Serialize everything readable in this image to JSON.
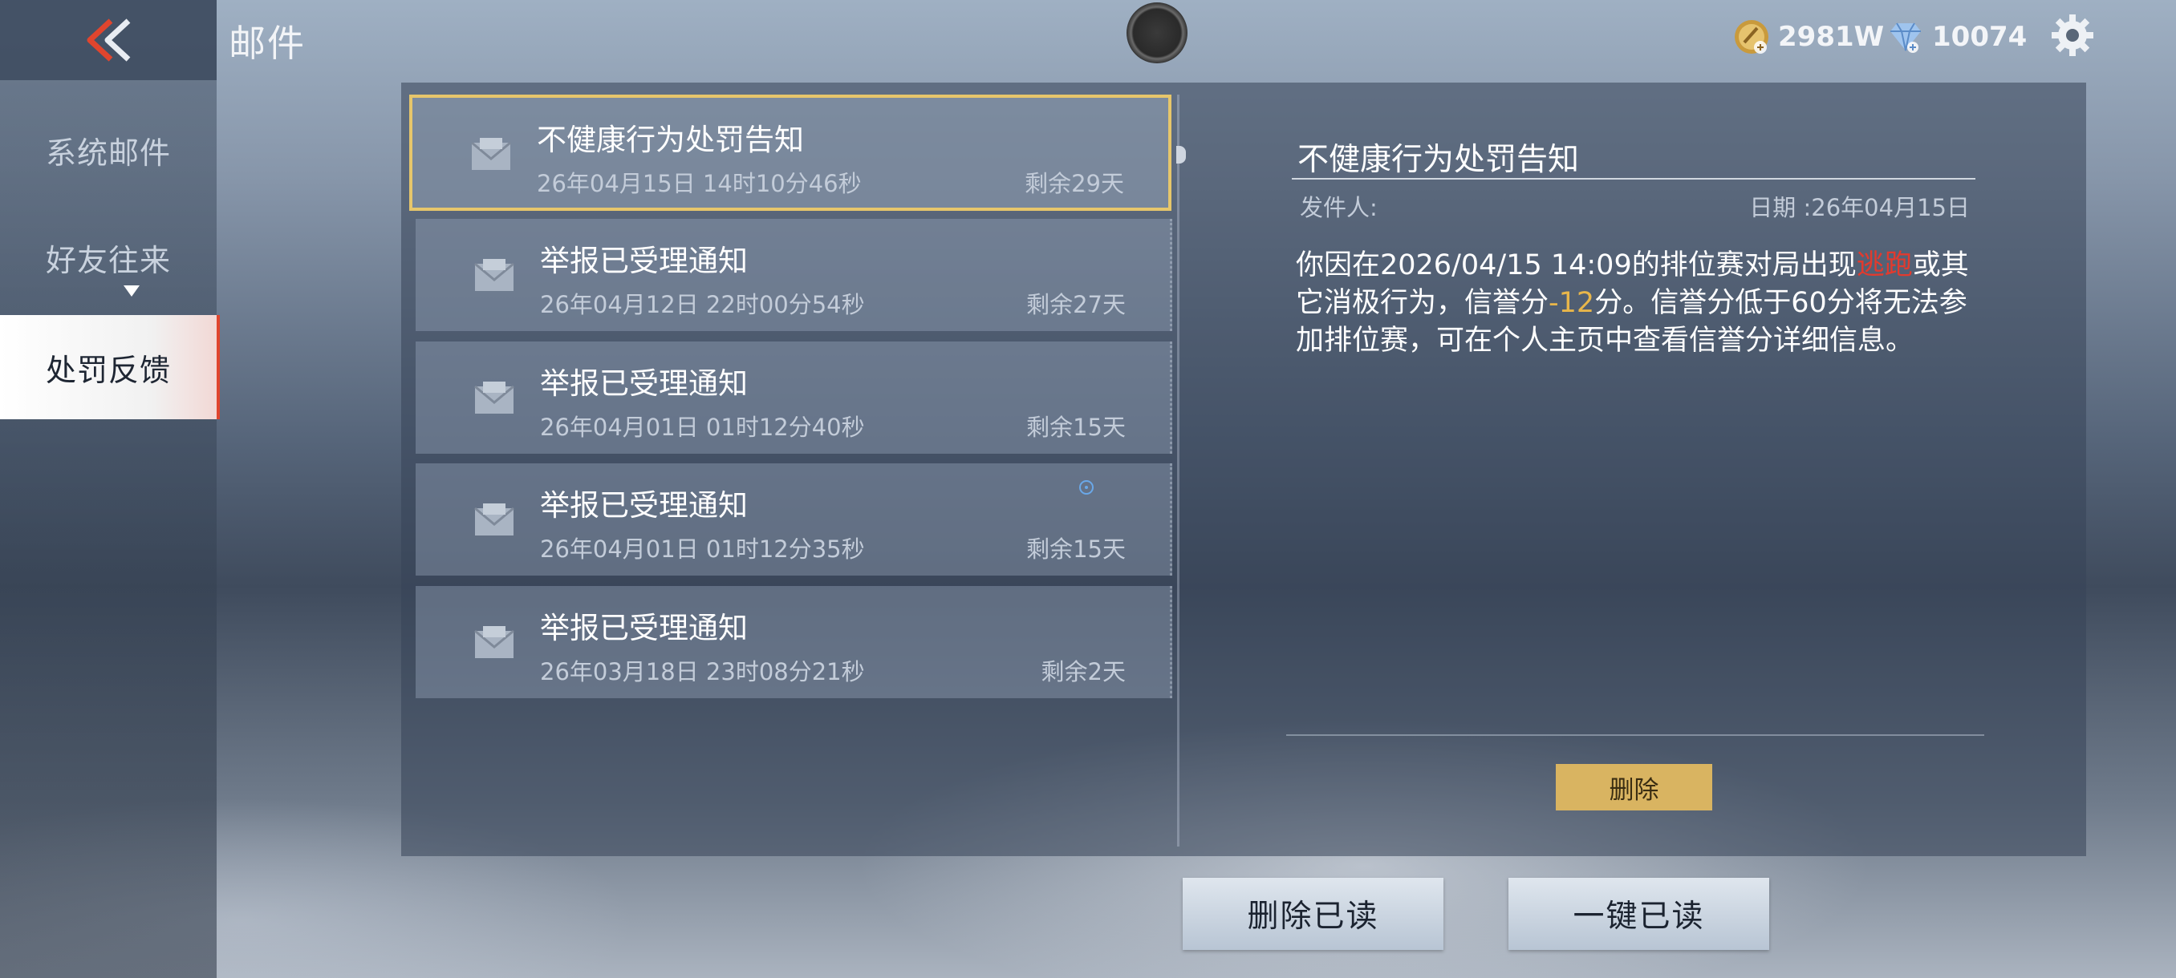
{
  "header": {
    "title": "邮件",
    "gold_amount": "2981W",
    "diamond_amount": "10074"
  },
  "sidebar": {
    "tabs": [
      {
        "label": "系统邮件"
      },
      {
        "label": "好友往来"
      },
      {
        "label": "处罚反馈"
      }
    ]
  },
  "mail_list": [
    {
      "title": "不健康行为处罚告知",
      "date": "26年04月15日 14时10分46秒",
      "remaining": "剩余29天"
    },
    {
      "title": "举报已受理通知",
      "date": "26年04月12日 22时00分54秒",
      "remaining": "剩余27天"
    },
    {
      "title": "举报已受理通知",
      "date": "26年04月01日 01时12分40秒",
      "remaining": "剩余15天"
    },
    {
      "title": "举报已受理通知",
      "date": "26年04月01日 01时12分35秒",
      "remaining": "剩余15天"
    },
    {
      "title": "举报已受理通知",
      "date": "26年03月18日 23时08分21秒",
      "remaining": "剩余2天"
    }
  ],
  "detail": {
    "title": "不健康行为处罚告知",
    "sender_label": "发件人:",
    "date_label": "日期 :26年04月15日",
    "body_part1": "你因在2026/04/15 14:09的排位赛对局出现",
    "body_red": "逃跑",
    "body_part2": "或其它消极行为，信誉分",
    "body_yellow": "-12",
    "body_part3": "分。信誉分低于60分将无法参加排位赛，可在个人主页中查看信誉分详细信息。",
    "delete_label": "删除"
  },
  "footer": {
    "delete_read_label": "删除已读",
    "read_all_label": "一键已读"
  },
  "colors": {
    "selected_border": "#e6c66b",
    "active_tab_accent": "#e0452e",
    "delete_button": "#d9b461",
    "warning_red": "#e23a2e",
    "penalty_yellow": "#e8b64a"
  }
}
